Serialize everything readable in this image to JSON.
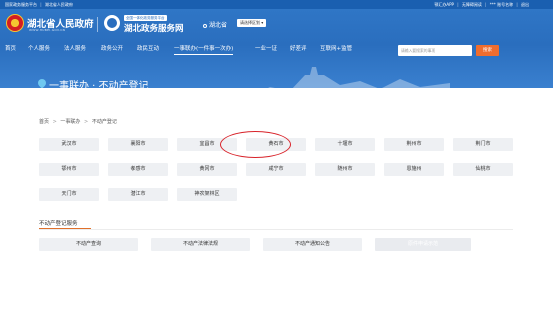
{
  "topbar": {
    "left_items": [
      "国家政务服务平台",
      "湖北省人民政府"
    ],
    "right_items": [
      "鄂汇办APP",
      "无障碍阅读",
      "*** 账号名称",
      "退出"
    ]
  },
  "header": {
    "gov_name": "湖北省人民政府",
    "gov_sub": "WWW.HUBEI.GOV.CN",
    "service_tag": "全国一体化政务服务平台",
    "service_name": "湖北政务服务网",
    "region": "湖北省",
    "region_select": "请选择区划 ▾"
  },
  "nav": {
    "items": [
      "首页",
      "个人服务",
      "法人服务",
      "政务公开",
      "政民互动",
      "一事联办(一件事一次办)",
      "一业一证",
      "好差评",
      "互联网+监管"
    ],
    "active_index": 5
  },
  "search": {
    "placeholder": "请输入要搜索的事项",
    "button_label": "搜索"
  },
  "banner": {
    "title": "一事联办 · 不动产登记"
  },
  "breadcrumb": {
    "items": [
      "首页",
      "一事联办",
      "不动产登记"
    ],
    "separator": ">"
  },
  "cities": {
    "row1": [
      "武汉市",
      "襄阳市",
      "宜昌市",
      "黄石市",
      "十堰市",
      "荆州市",
      "荆门市"
    ],
    "row2": [
      "鄂州市",
      "孝感市",
      "黄冈市",
      "咸宁市",
      "随州市",
      "恩施州",
      "仙桃市"
    ],
    "row3": [
      "天门市",
      "潜江市",
      "神农架林区"
    ],
    "highlighted": "黄石市"
  },
  "section": {
    "title": "不动产登记服务",
    "services": [
      "不动产查询",
      "不动产法律法规",
      "不动产通知公告",
      "原件申请示范"
    ]
  },
  "colors": {
    "header_blue": "#2a6ebe",
    "accent_orange": "#f06d2d",
    "highlight_red": "#d8232a"
  }
}
